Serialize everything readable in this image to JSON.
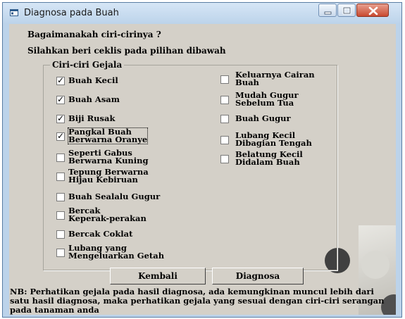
{
  "window": {
    "title": "Diagnosa pada Buah"
  },
  "heading": "Bagaimanakah ciri-cirinya ?",
  "instruction": "Silahkan beri ceklis pada pilihan dibawah",
  "group_label": "Ciri-ciri Gejala",
  "symptoms_left": [
    {
      "line1": "Buah Kecil",
      "line2": "",
      "checked": true
    },
    {
      "line1": "Buah Asam",
      "line2": "",
      "checked": true
    },
    {
      "line1": "Biji Rusak",
      "line2": "",
      "checked": true
    },
    {
      "line1": "Pangkal Buah",
      "line2": "Berwarna Oranye",
      "checked": true
    },
    {
      "line1": "Seperti Gabus",
      "line2": "Berwarna Kuning",
      "checked": false
    },
    {
      "line1": "Tepung Berwarna",
      "line2": "Hijau Kebiruan",
      "checked": false
    },
    {
      "line1": "Buah Sealalu Gugur",
      "line2": "",
      "checked": false
    },
    {
      "line1": "Bercak",
      "line2": "Keperak-perakan",
      "checked": false
    },
    {
      "line1": "Bercak Coklat",
      "line2": "",
      "checked": false
    },
    {
      "line1": "Lubang yang",
      "line2": "Mengeluarkan Getah",
      "checked": false
    }
  ],
  "symptoms_right": [
    {
      "line1": "Keluarnya Cairan",
      "line2": "Buah",
      "checked": false
    },
    {
      "line1": "Mudah Gugur",
      "line2": "Sebelum Tua",
      "checked": false
    },
    {
      "line1": "Buah Gugur",
      "line2": "",
      "checked": false
    },
    {
      "line1": "Lubang Kecil",
      "line2": "Dibagian Tengah",
      "checked": false
    },
    {
      "line1": "Belatung Kecil",
      "line2": "Didalam Buah",
      "checked": false
    }
  ],
  "buttons": {
    "back": "Kembali",
    "diagnose": "Diagnosa"
  },
  "note": "NB: Perhatikan gejala pada hasil diagnosa,  ada kemungkinan muncul lebih dari satu hasil diagnosa, maka perhatikan gejala yang sesuai dengan ciri-ciri serangan pada tanaman anda",
  "colors": {
    "frame": "#bcd3ea",
    "client": "#d4d0c8",
    "close": "#c94a31"
  },
  "icons": [
    "app-icon",
    "minimize-icon",
    "maximize-icon",
    "close-icon",
    "checkmark-icon"
  ]
}
